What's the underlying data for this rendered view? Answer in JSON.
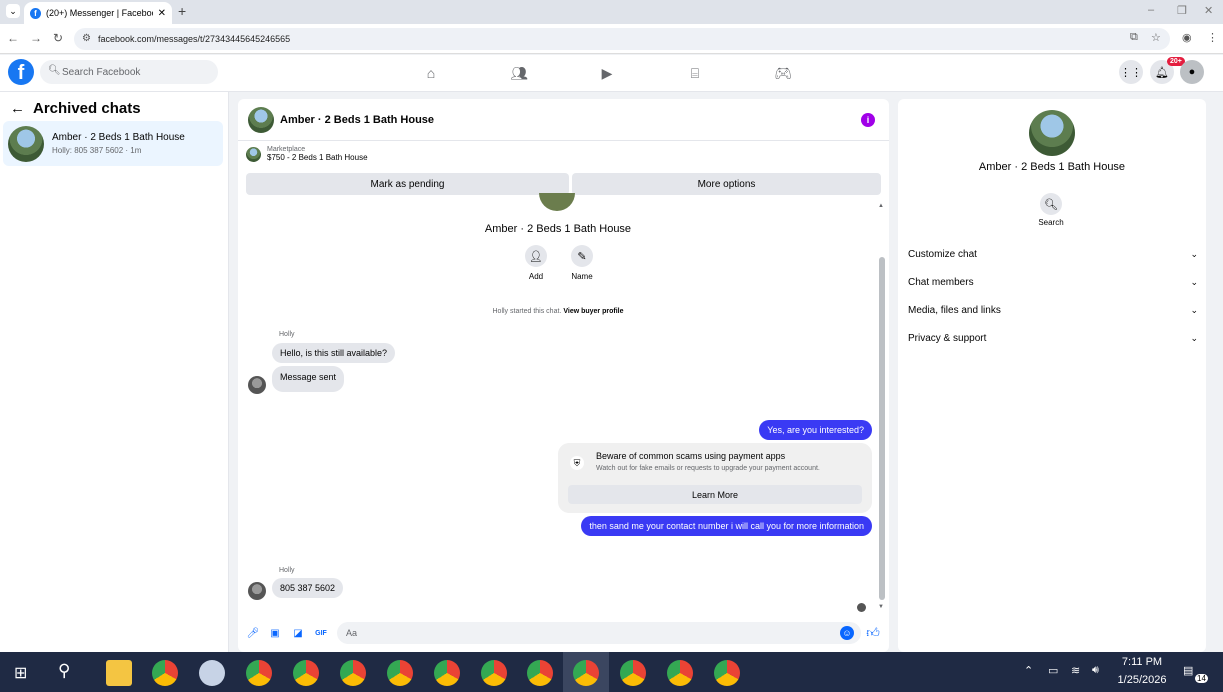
{
  "browser": {
    "tab_title": "(20+) Messenger | Facebook",
    "url": "facebook.com/messages/t/27343445645246565"
  },
  "fb": {
    "search_placeholder": "Search Facebook",
    "notification_badge": "20+"
  },
  "left": {
    "title": "Archived chats",
    "items": [
      {
        "name": "Amber · 2 Beds 1 Bath House",
        "snippet": "Holly: 805 387 5602 · 1m"
      }
    ]
  },
  "chat": {
    "title": "Amber · 2 Beds 1 Bath House",
    "marketplace_label": "Marketplace",
    "listing": "$750 - 2 Beds 1 Bath House",
    "mark_pending": "Mark as pending",
    "more_options": "More options",
    "profile_name": "Amber · 2 Beds 1 Bath House",
    "add_label": "Add",
    "name_label": "Name",
    "started_text": "Holly started this chat.",
    "view_buyer": "View buyer profile",
    "messages": [
      {
        "sender": "Holly",
        "text": "Hello, is this still available?"
      },
      {
        "text": "Message sent"
      },
      {
        "text": "Yes, are you interested?"
      },
      {
        "text": "then sand me your contact number i will call you for more information"
      },
      {
        "sender": "Holly",
        "text": "805 387 5602"
      }
    ],
    "scam_title": "Beware of common scams using payment apps",
    "scam_sub": "Watch out for fake emails or requests to upgrade your payment account.",
    "scam_button": "Learn More",
    "composer_placeholder": "Aa"
  },
  "right": {
    "name": "Amber · 2 Beds 1 Bath House",
    "search_label": "Search",
    "sections": [
      "Customize chat",
      "Chat members",
      "Media, files and links",
      "Privacy & support"
    ]
  },
  "taskbar": {
    "time": "7:11 PM",
    "date": "1/25/2026",
    "notif_count": "14"
  },
  "colors": {
    "fb_blue": "#1877f2",
    "outgoing_bubble": "#3a3af4",
    "info_purple": "#a000e8",
    "taskbar": "#1f2a44"
  }
}
